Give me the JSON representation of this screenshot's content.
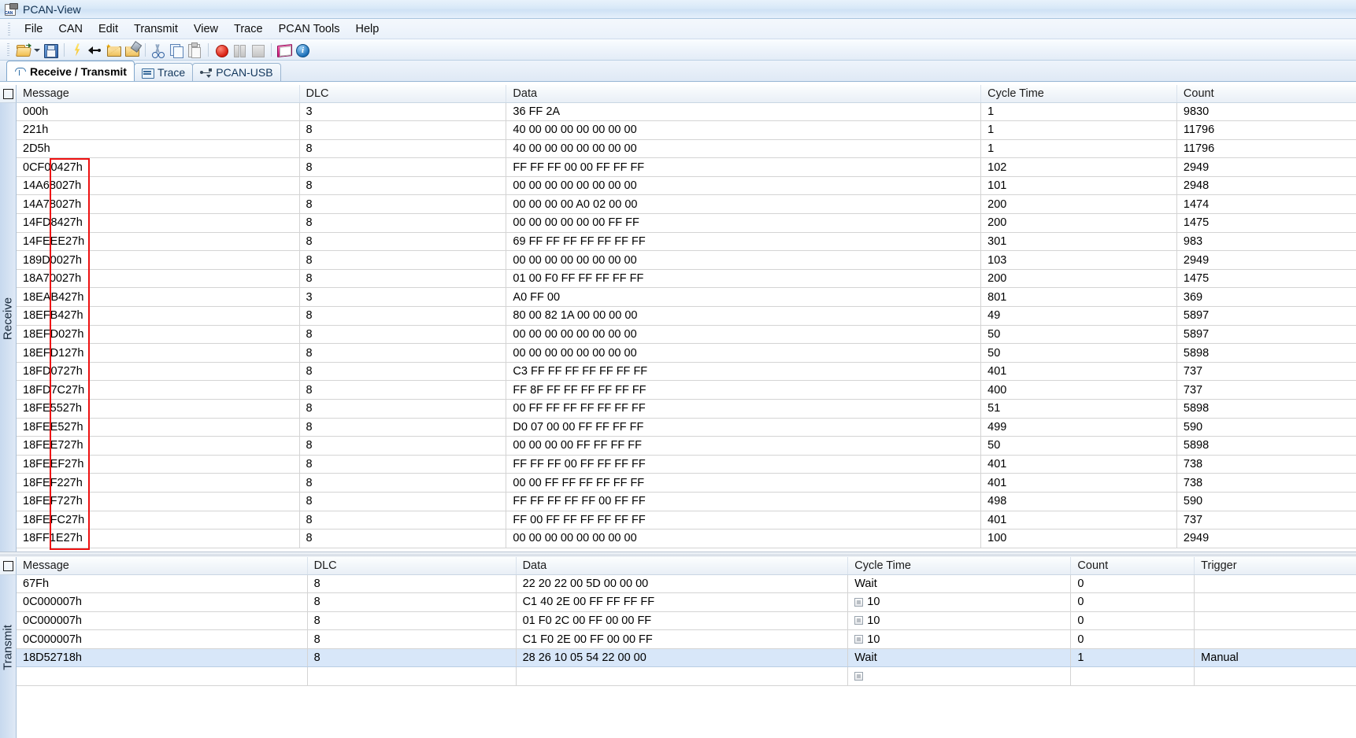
{
  "window": {
    "title": "PCAN-View",
    "icon": "pcan-view-icon"
  },
  "menubar": {
    "items": [
      {
        "label": "File",
        "accel": "F"
      },
      {
        "label": "CAN",
        "accel": "C"
      },
      {
        "label": "Edit",
        "accel": "E"
      },
      {
        "label": "Transmit",
        "accel": "T"
      },
      {
        "label": "View",
        "accel": "V"
      },
      {
        "label": "Trace",
        "accel": "a"
      },
      {
        "label": "PCAN Tools",
        "accel": "P"
      },
      {
        "label": "Help",
        "accel": "H"
      }
    ]
  },
  "toolbar": {
    "buttons": [
      "open-folder-icon",
      "dropdown-caret-icon",
      "save-icon",
      "separator",
      "connect-lightning-icon",
      "disconnect-arrow-icon",
      "new-message-icon",
      "edit-message-icon",
      "separator",
      "cut-icon",
      "copy-icon",
      "paste-icon",
      "separator",
      "record-icon",
      "pause-icon",
      "stop-icon",
      "separator",
      "manual-book-icon",
      "info-icon"
    ]
  },
  "tabs": [
    {
      "label": "Receive / Transmit",
      "icon": "receive-transmit-icon",
      "active": true
    },
    {
      "label": "Trace",
      "icon": "trace-window-icon",
      "active": false
    },
    {
      "label": "PCAN-USB",
      "icon": "usb-icon",
      "active": false
    }
  ],
  "receive_panel": {
    "side_label": "Receive",
    "columns": [
      "Message",
      "DLC",
      "Data",
      "Cycle Time",
      "Count"
    ],
    "rows": [
      {
        "message": "000h",
        "dlc": "3",
        "data": "36 FF 2A",
        "cycle_time": "1",
        "count": "9830"
      },
      {
        "message": "221h",
        "dlc": "8",
        "data": "40 00 00 00 00 00 00 00",
        "cycle_time": "1",
        "count": "11796"
      },
      {
        "message": "2D5h",
        "dlc": "8",
        "data": "40 00 00 00 00 00 00 00",
        "cycle_time": "1",
        "count": "11796"
      },
      {
        "message": "0CF00427h",
        "dlc": "8",
        "data": "FF FF FF 00 00 FF FF FF",
        "cycle_time": "102",
        "count": "2949"
      },
      {
        "message": "14A68027h",
        "dlc": "8",
        "data": "00 00 00 00 00 00 00 00",
        "cycle_time": "101",
        "count": "2948"
      },
      {
        "message": "14A78027h",
        "dlc": "8",
        "data": "00 00 00 00 A0 02 00 00",
        "cycle_time": "200",
        "count": "1474"
      },
      {
        "message": "14FD8427h",
        "dlc": "8",
        "data": "00 00 00 00 00 00 FF FF",
        "cycle_time": "200",
        "count": "1475"
      },
      {
        "message": "14FEEE27h",
        "dlc": "8",
        "data": "69 FF FF FF FF FF FF FF",
        "cycle_time": "301",
        "count": "983"
      },
      {
        "message": "189D0027h",
        "dlc": "8",
        "data": "00 00 00 00 00 00 00 00",
        "cycle_time": "103",
        "count": "2949"
      },
      {
        "message": "18A70027h",
        "dlc": "8",
        "data": "01 00 F0 FF FF FF FF FF",
        "cycle_time": "200",
        "count": "1475"
      },
      {
        "message": "18EAB427h",
        "dlc": "3",
        "data": "A0 FF 00",
        "cycle_time": "801",
        "count": "369"
      },
      {
        "message": "18EFB427h",
        "dlc": "8",
        "data": "80 00 82 1A 00 00 00 00",
        "cycle_time": "49",
        "count": "5897"
      },
      {
        "message": "18EFD027h",
        "dlc": "8",
        "data": "00 00 00 00 00 00 00 00",
        "cycle_time": "50",
        "count": "5897"
      },
      {
        "message": "18EFD127h",
        "dlc": "8",
        "data": "00 00 00 00 00 00 00 00",
        "cycle_time": "50",
        "count": "5898"
      },
      {
        "message": "18FD0727h",
        "dlc": "8",
        "data": "C3 FF FF FF FF FF FF FF",
        "cycle_time": "401",
        "count": "737"
      },
      {
        "message": "18FD7C27h",
        "dlc": "8",
        "data": "FF 8F FF FF FF FF FF FF",
        "cycle_time": "400",
        "count": "737"
      },
      {
        "message": "18FE5527h",
        "dlc": "8",
        "data": "00 FF FF FF FF FF FF FF",
        "cycle_time": "51",
        "count": "5898"
      },
      {
        "message": "18FEE527h",
        "dlc": "8",
        "data": "D0 07 00 00 FF FF FF FF",
        "cycle_time": "499",
        "count": "590"
      },
      {
        "message": "18FEE727h",
        "dlc": "8",
        "data": "00 00 00 00 FF FF FF FF",
        "cycle_time": "50",
        "count": "5898"
      },
      {
        "message": "18FEEF27h",
        "dlc": "8",
        "data": "FF FF FF 00 FF FF FF FF",
        "cycle_time": "401",
        "count": "738"
      },
      {
        "message": "18FEF227h",
        "dlc": "8",
        "data": "00 00 FF FF FF FF FF FF",
        "cycle_time": "401",
        "count": "738"
      },
      {
        "message": "18FEF727h",
        "dlc": "8",
        "data": "FF FF FF FF FF 00 FF FF",
        "cycle_time": "498",
        "count": "590"
      },
      {
        "message": "18FEFC27h",
        "dlc": "8",
        "data": "FF 00 FF FF FF FF FF FF",
        "cycle_time": "401",
        "count": "737"
      },
      {
        "message": "18FF1E27h",
        "dlc": "8",
        "data": "00 00 00 00 00 00 00 00",
        "cycle_time": "100",
        "count": "2949"
      }
    ]
  },
  "transmit_panel": {
    "side_label": "Transmit",
    "columns": [
      "Message",
      "DLC",
      "Data",
      "Cycle Time",
      "Count",
      "Trigger"
    ],
    "rows": [
      {
        "message": "67Fh",
        "dlc": "8",
        "data": "22 20 22 00 5D 00 00 00",
        "cycle_time": "Wait",
        "cycle_checkbox": false,
        "count": "0",
        "trigger": "",
        "selected": false
      },
      {
        "message": "0C000007h",
        "dlc": "8",
        "data": "C1 40 2E 00 FF FF FF FF",
        "cycle_time": "10",
        "cycle_checkbox": true,
        "count": "0",
        "trigger": "",
        "selected": false
      },
      {
        "message": "0C000007h",
        "dlc": "8",
        "data": "01 F0 2C 00 FF 00 00 FF",
        "cycle_time": "10",
        "cycle_checkbox": true,
        "count": "0",
        "trigger": "",
        "selected": false
      },
      {
        "message": "0C000007h",
        "dlc": "8",
        "data": "C1 F0 2E 00 FF 00 00 FF",
        "cycle_time": "10",
        "cycle_checkbox": true,
        "count": "0",
        "trigger": "",
        "selected": false
      },
      {
        "message": "18D52718h",
        "dlc": "8",
        "data": "28 26 10 05 54 22 00 00",
        "cycle_time": "Wait",
        "cycle_checkbox": false,
        "count": "1",
        "trigger": "Manual",
        "selected": true
      },
      {
        "message": "",
        "dlc": "",
        "data": "",
        "cycle_time": "",
        "cycle_checkbox": true,
        "count": "",
        "trigger": "",
        "selected": false
      }
    ]
  },
  "annotation": {
    "shape": "rectangle",
    "color": "#ee1111",
    "target": "message-id-column-digits"
  }
}
